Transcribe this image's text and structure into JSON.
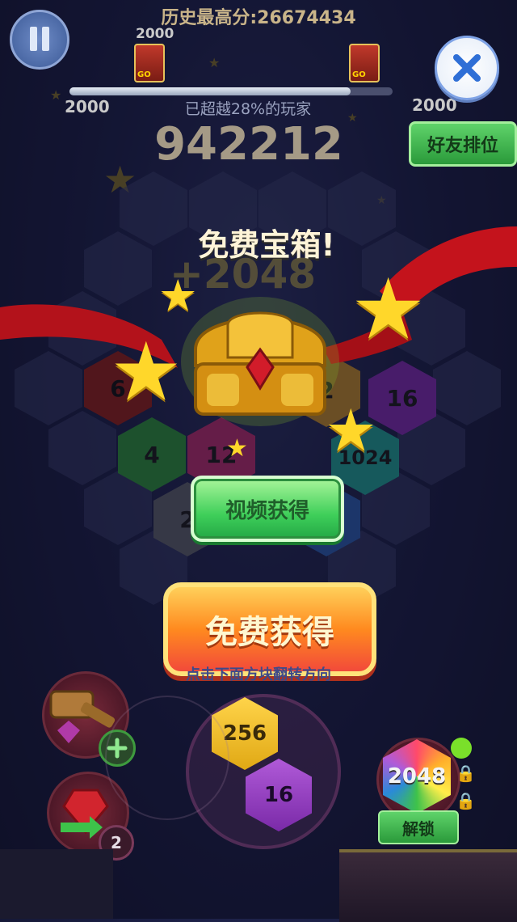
{
  "header": {
    "best_score_label": "历史最高分:",
    "best_score_value": "26674434",
    "progress_left_top": "2000",
    "progress_left_bottom": "2000",
    "progress_right_bottom": "2000",
    "percent_text": "已超越28%的玩家",
    "progress_fraction": 0.87,
    "current_score": "942212",
    "friends_button": "好友排位"
  },
  "popup": {
    "title": "免费宝箱!",
    "bonus": "+2048",
    "video_button": "视频获得",
    "free_button": "免费获得"
  },
  "board": {
    "tiles": [
      "6",
      "4",
      "12",
      "2",
      "16",
      "1024",
      "2",
      "2"
    ],
    "hint": "点击下面方块翻转方向"
  },
  "bottom": {
    "next_top": "256",
    "next_bottom": "16",
    "power_count": "2",
    "locked_tile": "2048",
    "unlock_button": "解锁"
  },
  "icons": {
    "pause": "pause-icon",
    "close": "close-icon",
    "chest": "treasure-chest-icon",
    "hammer": "hammer-icon",
    "swap": "swap-gem-icon",
    "lock": "lock-icon",
    "plus": "plus-icon"
  },
  "colors": {
    "score_gold": "#c9b489",
    "button_green": "#3fcf5a",
    "button_orange": "#ff8a1f",
    "ribbon_red": "#c4131c"
  }
}
